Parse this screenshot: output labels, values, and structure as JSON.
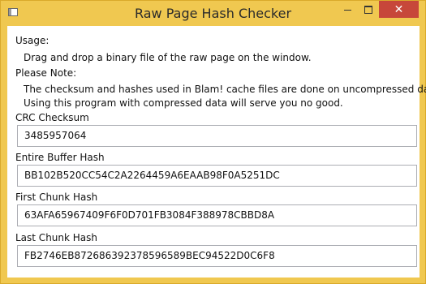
{
  "window": {
    "title": "Raw Page Hash Checker",
    "icon": "app-window-icon",
    "controls": {
      "minimize_icon": "minimize-icon",
      "maximize_icon": "maximize-icon",
      "close_glyph": "✕"
    }
  },
  "usage": {
    "heading": "Usage:",
    "text": "Drag and drop a binary file of the raw page on the window."
  },
  "note": {
    "heading": "Please Note:",
    "line1": "The checksum and hashes used in Blam! cache files are done on uncompressed data.",
    "line2": "Using this program with compressed data will serve you no good."
  },
  "fields": {
    "crc": {
      "label": "CRC Checksum",
      "value": "3485957064"
    },
    "entire": {
      "label": "Entire Buffer Hash",
      "value": "BB102B520CC54C2A2264459A6EAAB98F0A5251DC"
    },
    "first": {
      "label": "First Chunk Hash",
      "value": "63AFA65967409F6F0D701FB3084F388978CBBD8A"
    },
    "last": {
      "label": "Last Chunk Hash",
      "value": "FB2746EB872686392378596589BEC94522D0C6F8"
    }
  },
  "colors": {
    "frame": "#f0c850",
    "close_button": "#c7473a",
    "field_border": "#abadb3"
  }
}
